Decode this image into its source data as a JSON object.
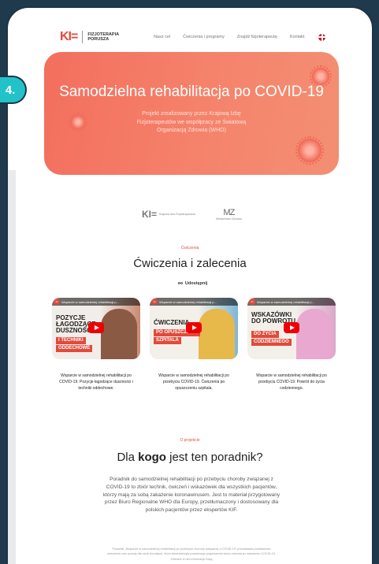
{
  "step_badge": "4.",
  "brand": {
    "mark": "KI=",
    "line1": "FIZJOTERAPIA",
    "line2": "PORUSZA"
  },
  "nav": {
    "links": [
      "Nasz cel",
      "Ćwiczenia i programy",
      "Znajdź fizjoterapeutę",
      "Kontakt"
    ]
  },
  "hero": {
    "title": "Samodzielna rehabilitacja po COVID-19",
    "subtitle": "Projekt zrealizowany przez Krajową Izbę Fizjoterapeutów we współpracy ze Światową Organizacją Zdrowia (WHO)"
  },
  "partners": {
    "kif_mark": "KI=",
    "kif_text": "Krajowa Izba Fizjoterapeutów",
    "mz_mark": "MZ",
    "mz_text": "Ministerstwo Zdrowia"
  },
  "exercises": {
    "kicker": "Ćwiczenia",
    "title": "Ćwiczenia i zalecenia",
    "share": "Udostępnij",
    "videos": [
      {
        "bar": "Wsparcie w samodzielnej rehabilitacji p...",
        "line1": "POZYCJE ŁAGODZĄCE DUSZNOŚCI",
        "tag1": "I TECHNIKI",
        "tag2": "ODDECHOWE",
        "caption": "Wsparcie w samodzielnej rehabilitacji po COVID-19. Pozycje łagodzące duszności i techniki oddechowe."
      },
      {
        "bar": "Wsparcie w samodzielnej rehabilitacji p...",
        "line1": "ĆWICZENIA",
        "tag1": "PO OPUSZCZENIU",
        "tag2": "SZPITALA",
        "caption": "Wsparcie w samodzielnej rehabilitacji po przebyciu COVID-19. Ćwiczenia po opuszczeniu szpitala."
      },
      {
        "bar": "Wsparcie w samodzielnej rehabilitacji p...",
        "line1": "WSKAZÓWKI DO POWROTU",
        "tag1": "DO ŻYCIA",
        "tag2": "CODZIENNEGO",
        "caption": "Wsparcie w samodzielnej rehabilitacji po przebyciu COVID-19. Powrót do życia codziennego."
      }
    ]
  },
  "about": {
    "kicker": "O projekcie",
    "title_pre": "Dla ",
    "title_bold": "kogo",
    "title_post": " jest ten poradnik?",
    "body": "Poradnik do samodzielnej rehabilitacji po przebyciu choroby związanej z COVID-19 to zbiór technik, ćwiczeń i wskazówek dla wszystkich pacjentów, którzy mają za sobą zakażenie koronawirusem. Jest to materiał przygotowany przez Biuro Regionalne WHO dla Europy, przetłumaczony i dostosowany dla polskich pacjentów przez ekspertów KIF.",
    "fine": "Poradnik „Wsparcie w samodzielnej rehabilitacji po przebyciu choroby związanej z COVID-19” przedstawia podstawowe ćwiczenia oraz porady dla osób dorosłych, które doświadczyły poważnego pogorszenia stanu zdrowia po zakażeniu COVID-19. Zebrane w nim informacje mają"
  },
  "colors": {
    "accent": "#e24a3b",
    "hero": "#f36e5e",
    "badge": "#22c3c8",
    "frame": "#1f3a4d"
  }
}
